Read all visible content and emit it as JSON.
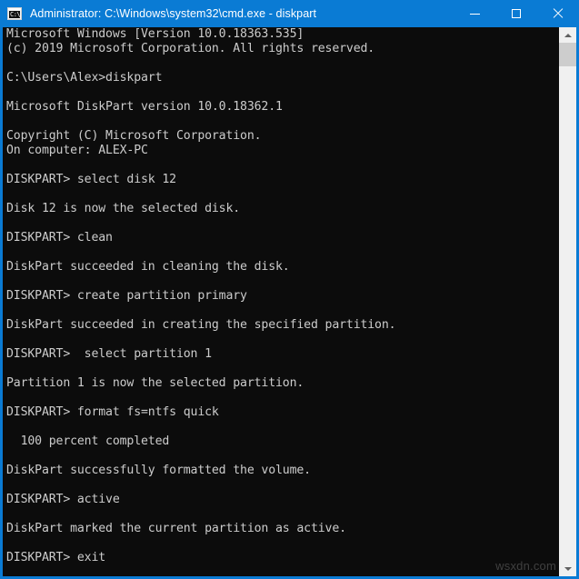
{
  "window": {
    "title": "Administrator: C:\\Windows\\system32\\cmd.exe - diskpart",
    "icon": "cmd-console-icon",
    "icon_prompt_text": "C:\\.",
    "titlebar_color": "#0a7bd4",
    "background_color": "#0c0c0c",
    "text_color": "#cccccc",
    "controls": {
      "minimize_label": "Minimize",
      "maximize_label": "Maximize",
      "close_label": "Close"
    }
  },
  "scrollbar": {
    "up_label": "Scroll up",
    "down_label": "Scroll down",
    "thumb_label": "Scroll thumb"
  },
  "watermark": {
    "text": "wsxdn.com"
  },
  "console": {
    "lines": [
      "Microsoft Windows [Version 10.0.18363.535]",
      "(c) 2019 Microsoft Corporation. All rights reserved.",
      "",
      "C:\\Users\\Alex>diskpart",
      "",
      "Microsoft DiskPart version 10.0.18362.1",
      "",
      "Copyright (C) Microsoft Corporation.",
      "On computer: ALEX-PC",
      "",
      "DISKPART> select disk 12",
      "",
      "Disk 12 is now the selected disk.",
      "",
      "DISKPART> clean",
      "",
      "DiskPart succeeded in cleaning the disk.",
      "",
      "DISKPART> create partition primary",
      "",
      "DiskPart succeeded in creating the specified partition.",
      "",
      "DISKPART>  select partition 1",
      "",
      "Partition 1 is now the selected partition.",
      "",
      "DISKPART> format fs=ntfs quick",
      "",
      "  100 percent completed",
      "",
      "DiskPart successfully formatted the volume.",
      "",
      "DISKPART> active",
      "",
      "DiskPart marked the current partition as active.",
      "",
      "DISKPART> exit",
      ""
    ]
  }
}
